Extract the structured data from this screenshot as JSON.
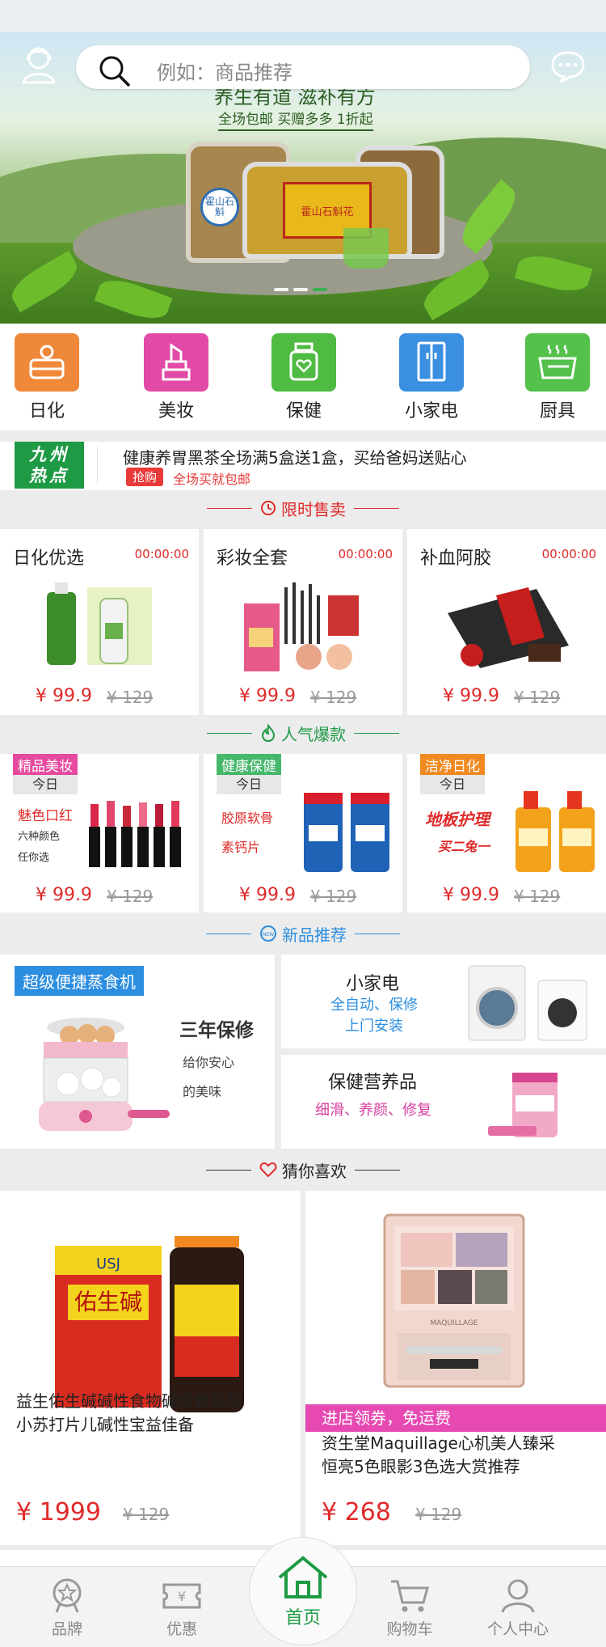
{
  "header": {
    "search_placeholder": "例如：商品推荐",
    "user_icon": "user-icon",
    "message_icon": "message-icon"
  },
  "banner": {
    "slogan": "养生有道 滋补有方",
    "sub": "全场包邮  买赠多多  1折起",
    "seal": "霍山石斛",
    "jar_label": "霍山石斛花",
    "slide_count": 3,
    "active_slide": 3
  },
  "categories": [
    {
      "label": "日化",
      "color": "#f0883a",
      "icon": "daily-care-icon"
    },
    {
      "label": "美妆",
      "color": "#e24aa8",
      "icon": "lipstick-icon"
    },
    {
      "label": "保健",
      "color": "#4fbb42",
      "icon": "health-jar-icon"
    },
    {
      "label": "小家电",
      "color": "#3a8fe0",
      "icon": "fridge-icon"
    },
    {
      "label": "厨具",
      "color": "#53c14a",
      "icon": "cookware-icon"
    }
  ],
  "hot_news": {
    "badge_line1": "九州",
    "badge_line2": "热点",
    "title": "健康养胃黑茶全场满5盒送1盒，买给爸妈送贴心",
    "tag": "抢购",
    "sub": "全场买就包邮"
  },
  "sections": {
    "flash_sale": "限时售卖",
    "popular": "人气爆款",
    "new_products": "新品推荐",
    "guess_you_like": "猜你喜欢"
  },
  "flash_sale": [
    {
      "name": "日化优选",
      "time": "00:00:00",
      "price": "¥ 99.9",
      "old_price": "¥ 129"
    },
    {
      "name": "彩妆全套",
      "time": "00:00:00",
      "price": "¥ 99.9",
      "old_price": "¥ 129"
    },
    {
      "name": "补血阿胶",
      "time": "00:00:00",
      "price": "¥ 99.9",
      "old_price": "¥ 129"
    }
  ],
  "popular": [
    {
      "tag": "精品美妆",
      "today": "今日",
      "line1": "魅色口红",
      "line2": "六种颜色",
      "line3": "任你选",
      "price": "¥ 99.9",
      "old_price": "¥ 129"
    },
    {
      "tag": "健康保健",
      "today": "今日",
      "line1": "胶原软骨",
      "line2": "素钙片",
      "price": "¥ 99.9",
      "old_price": "¥ 129"
    },
    {
      "tag": "洁净日化",
      "today": "今日",
      "line1": "地板护理",
      "line2": "买二兔一",
      "price": "¥ 99.9",
      "old_price": "¥ 129"
    }
  ],
  "new_products": {
    "steamer": {
      "tag": "超级便捷蒸食机",
      "line1": "三年保修",
      "line2": "给你安心",
      "line3": "的美味"
    },
    "appliance": {
      "title": "小家电",
      "sub1": "全自动、保修",
      "sub2": "上门安装"
    },
    "supplement": {
      "title": "保健营养品",
      "sub": "细滑、养颜、修复"
    }
  },
  "recommend": [
    {
      "title_line1": "益生佑生碱碱性食物碱性食品孕",
      "title_line2": "小苏打片儿碱性宝益佳备",
      "price": "¥ 1999",
      "old_price": "¥ 129",
      "brand": "USJ",
      "product_name": "佑生碱"
    },
    {
      "coupon": "进店领券，免运费",
      "title_line1": "资生堂Maquillage心机美人臻采",
      "title_line2": "恒亮5色眼影3色选大赏推荐",
      "price": "¥ 268",
      "old_price": "¥ 129",
      "brand": "MAQUILLAGE"
    }
  ],
  "tabbar": [
    {
      "label": "品牌",
      "icon": "brand-icon"
    },
    {
      "label": "优惠",
      "icon": "coupon-icon"
    },
    {
      "label": "首页",
      "icon": "home-icon",
      "active": true
    },
    {
      "label": "购物车",
      "icon": "cart-icon"
    },
    {
      "label": "个人中心",
      "icon": "profile-icon"
    }
  ],
  "colors": {
    "accent_red": "#e02a2a",
    "brand_green": "#1e9a45",
    "tag_blue": "#2c8ee0",
    "tag_pink": "#e64ab2"
  }
}
